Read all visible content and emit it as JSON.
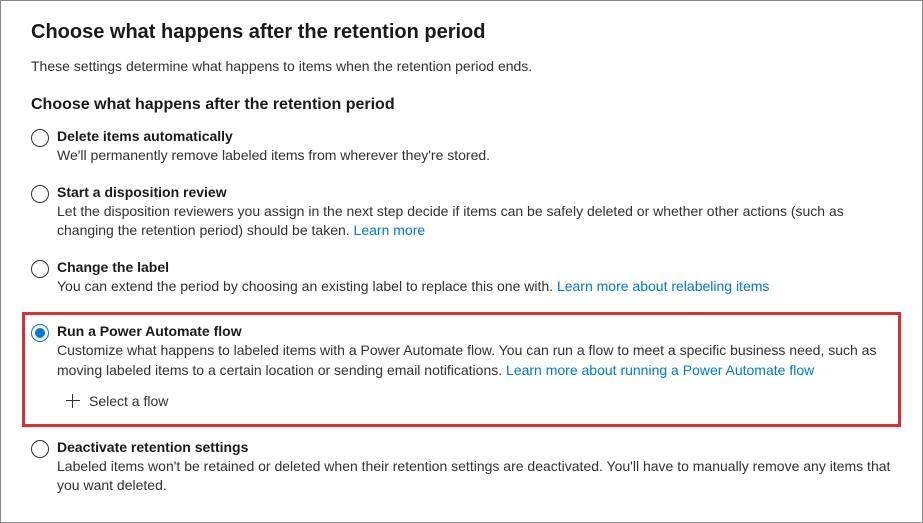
{
  "page": {
    "title": "Choose what happens after the retention period",
    "subtitle": "These settings determine what happens to items when the retention period ends.",
    "section_heading": "Choose what happens after the retention period"
  },
  "options": {
    "delete": {
      "title": "Delete items automatically",
      "desc": "We'll permanently remove labeled items from wherever they're stored."
    },
    "disposition": {
      "title": "Start a disposition review",
      "desc": "Let the disposition reviewers you assign in the next step decide if items can be safely deleted or whether other actions (such as changing the retention period) should be taken.  ",
      "link": "Learn more"
    },
    "change_label": {
      "title": "Change the label",
      "desc": "You can extend the period by choosing an existing label to replace this one with. ",
      "link": "Learn more about relabeling items"
    },
    "power_automate": {
      "title": "Run a Power Automate flow",
      "desc": "Customize what happens to labeled items with a Power Automate flow. You can run a flow to meet a specific business need, such as moving labeled items to a certain location or sending email notifications. ",
      "link": "Learn more about running a Power Automate flow",
      "select_flow_label": "Select a flow"
    },
    "deactivate": {
      "title": "Deactivate retention settings",
      "desc": "Labeled items won't be retained or deleted when their retention settings are deactivated. You'll have to manually remove any items that you want deleted."
    }
  }
}
